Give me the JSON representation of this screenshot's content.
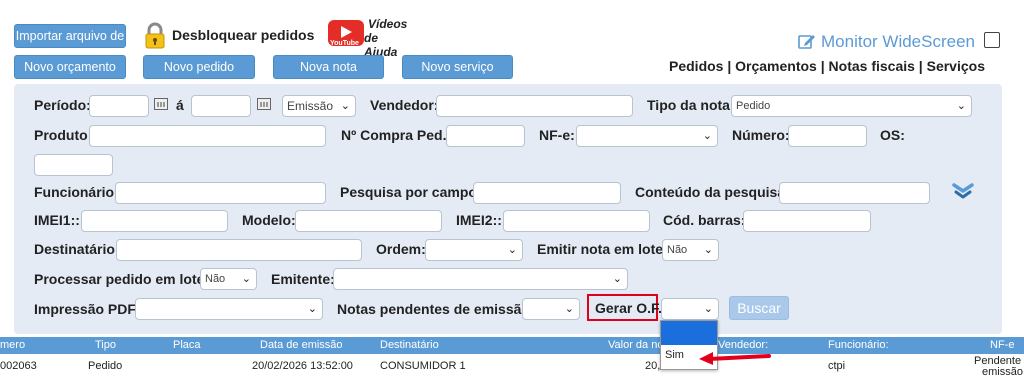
{
  "toolbar": {
    "import_label": "Importar arquivo de",
    "unlock_label": "Desbloquear pedidos",
    "video_line1": "Vídeos",
    "video_line2": "de Ajuda",
    "youtube": "YouTube",
    "new_budget": "Novo orçamento",
    "new_order": "Novo pedido",
    "new_invoice": "Nova nota",
    "new_service": "Novo serviço",
    "monitor_label": "Monitor WideScreen",
    "nav": "Pedidos | Orçamentos | Notas fiscais | Serviços"
  },
  "filters": {
    "periodo": "Período:",
    "a": "á",
    "emissao": "Emissão",
    "vendedor": "Vendedor:",
    "tipo_nota": "Tipo da nota:",
    "tipo_nota_value": "Pedido",
    "produto": "Produto:",
    "compra_ped": "Nº Compra Ped.:",
    "nfe": "NF-e:",
    "numero": "Número:",
    "os": "OS:",
    "funcionario": "Funcionário:",
    "pesquisa_campo": "Pesquisa por campo:",
    "conteudo_pesquisa": "Conteúdo da pesquisa:",
    "imei1": "IMEI1::",
    "modelo": "Modelo:",
    "imei2": "IMEI2::",
    "cod_barras": "Cód. barras:",
    "destinatario": "Destinatário:",
    "ordem": "Ordem:",
    "emitir_lote": "Emitir nota em lote:",
    "emitir_lote_value": "Não",
    "processar_lote": "Processar pedido em lote:",
    "processar_lote_value": "Não",
    "emitente": "Emitente:",
    "impressao_pdf": "Impressão PDF:",
    "notas_pendentes": "Notas pendentes de emissão:",
    "gerar_of": "Gerar O.F.",
    "buscar": "Buscar"
  },
  "dropdown": {
    "options": [
      "",
      "Sim"
    ]
  },
  "table": {
    "headers": [
      "mero",
      "Tipo",
      "Placa",
      "Data de emissão",
      "Destinatário",
      "Valor da no",
      "Vendedor:",
      "Funcionário:",
      "NF-e"
    ],
    "row": {
      "numero": "002063",
      "tipo": "Pedido",
      "data": "20/02/2026 13:52:00",
      "destinatario": "CONSUMIDOR 1",
      "valor": "20,",
      "funcionario": "ctpi",
      "nfe_line1": "Pendente",
      "nfe_line2": "emissão"
    }
  },
  "colors": {
    "button": "#5b9bd5",
    "panel": "#e4ebf5",
    "header_row": "#5b9bd5",
    "highlight": "#e0001b",
    "dropdown_selected": "#1a6fdc"
  },
  "icons": [
    "lock-icon",
    "youtube-icon",
    "edit-icon",
    "checkbox-icon",
    "calendar-icon",
    "expand-chevron-icon",
    "red-arrow-icon"
  ]
}
